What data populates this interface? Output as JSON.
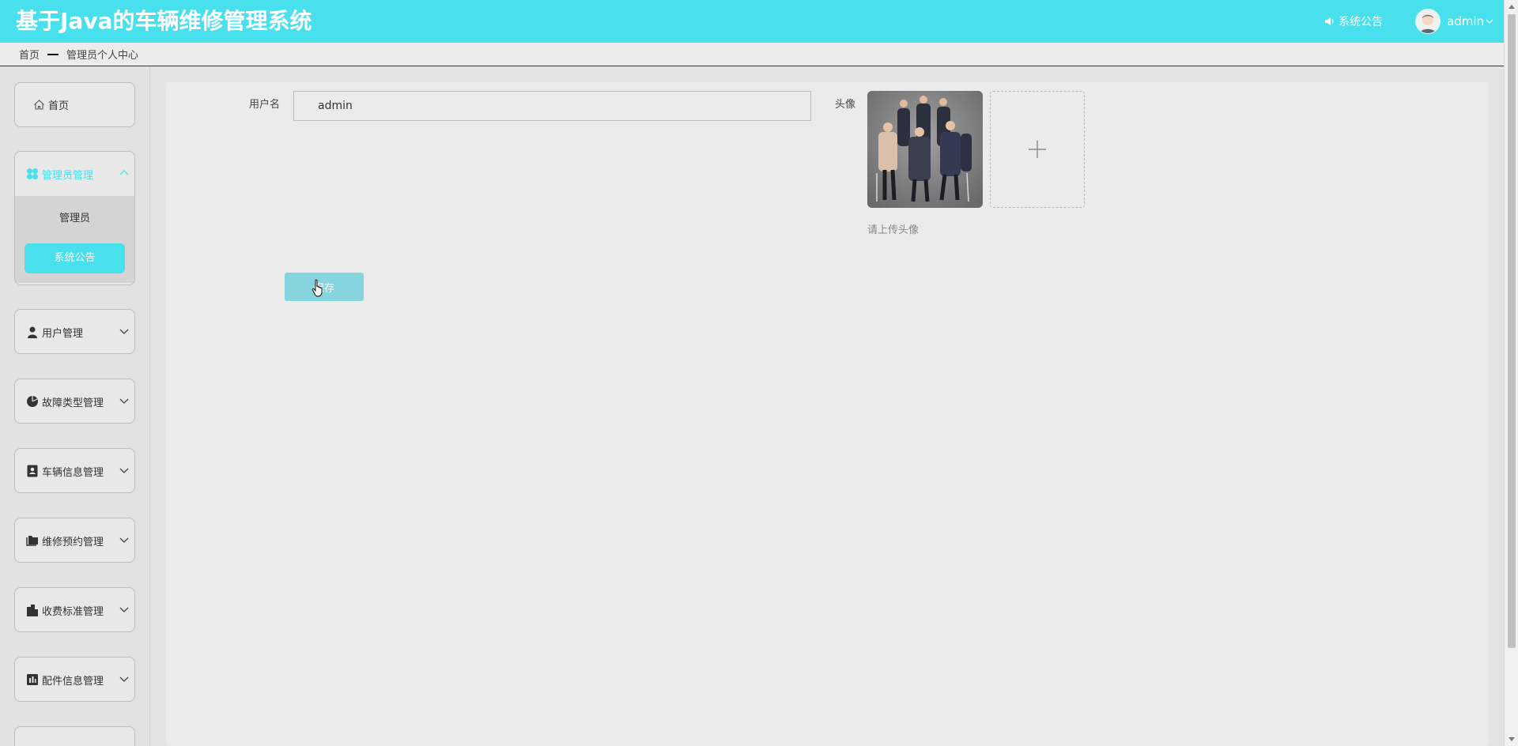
{
  "header": {
    "title": "基于Java的车辆维修管理系统",
    "notice_label": "系统公告",
    "username": "admin"
  },
  "breadcrumb": {
    "home": "首页",
    "current": "管理员个人中心"
  },
  "sidebar": {
    "home": "首页",
    "groups": [
      {
        "label": "管理员管理",
        "icon": "grid-icon",
        "expanded": true,
        "items": [
          {
            "label": "管理员"
          },
          {
            "label": "系统公告"
          }
        ]
      },
      {
        "label": "用户管理",
        "icon": "user-icon"
      },
      {
        "label": "故障类型管理",
        "icon": "pie-icon"
      },
      {
        "label": "车辆信息管理",
        "icon": "contact-icon"
      },
      {
        "label": "维修预约管理",
        "icon": "folder-icon"
      },
      {
        "label": "收费标准管理",
        "icon": "building-icon"
      },
      {
        "label": "配件信息管理",
        "icon": "chart-icon"
      }
    ]
  },
  "form": {
    "username_label": "用户名",
    "username_value": "admin",
    "avatar_label": "头像",
    "upload_hint": "请上传头像",
    "save_label": "保存"
  },
  "colors": {
    "accent": "#47e0ec",
    "button": "#86d5de"
  }
}
